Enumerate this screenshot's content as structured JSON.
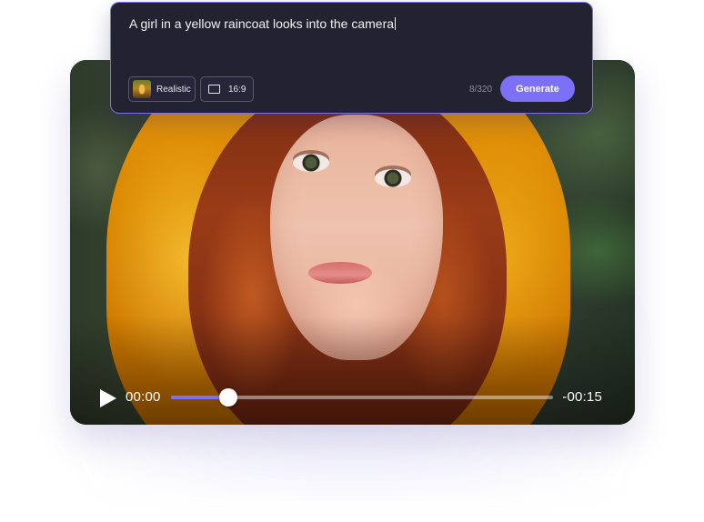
{
  "prompt": {
    "text": "A girl in a yellow raincoat looks into the camera",
    "style_chip": {
      "label": "Realistic",
      "thumbnail_icon": "style-thumbnail"
    },
    "ratio_chip": {
      "label": "16:9",
      "icon": "aspect-ratio-icon"
    },
    "char_counter": "8/320",
    "generate_label": "Generate"
  },
  "player": {
    "play_icon": "play-icon",
    "time_current": "00:00",
    "time_remaining": "-00:15",
    "progress_fraction": 0.15
  },
  "colors": {
    "accent": "#7b70f7",
    "panel_bg": "#232230",
    "panel_border": "#7b70ef",
    "progress_fill": "#7c70ff"
  }
}
